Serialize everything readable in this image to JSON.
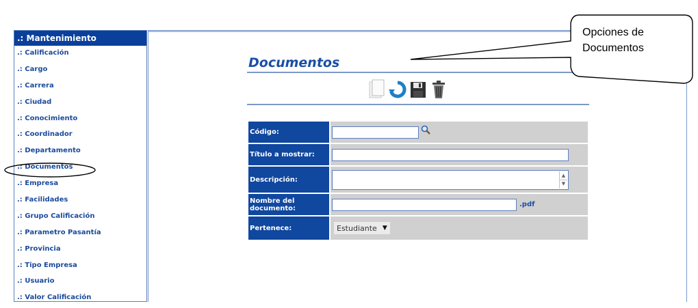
{
  "sidebar": {
    "header": ".: Mantenimiento",
    "bullet": ".:",
    "items": [
      {
        "label": "Calificación"
      },
      {
        "label": "Cargo"
      },
      {
        "label": "Carrera"
      },
      {
        "label": "Ciudad"
      },
      {
        "label": "Conocimiento"
      },
      {
        "label": "Coordinador"
      },
      {
        "label": "Departamento"
      },
      {
        "label": "Documentos"
      },
      {
        "label": "Empresa"
      },
      {
        "label": "Facilidades"
      },
      {
        "label": "Grupo Calificación"
      },
      {
        "label": "Parametro Pasantía"
      },
      {
        "label": "Provincia"
      },
      {
        "label": "Tipo Empresa"
      },
      {
        "label": "Usuario"
      },
      {
        "label": "Valor Calificación"
      }
    ]
  },
  "main": {
    "title": "Documentos",
    "toolbar": {
      "icons": [
        "new-document-icon",
        "refresh-icon",
        "save-icon",
        "delete-icon"
      ]
    },
    "form": {
      "codigo_label": "Código:",
      "codigo_value": "",
      "titulo_label": "Título a mostrar:",
      "titulo_value": "",
      "descripcion_label": "Descripción:",
      "descripcion_value": "",
      "nombre_label": "Nombre del documento:",
      "nombre_value": "",
      "nombre_suffix": ".pdf",
      "pertenece_label": "Pertenece:",
      "pertenece_selected": "Estudiante"
    }
  },
  "callout": {
    "text": "Opciones de Documentos"
  },
  "colors": {
    "sidebar_header": "#0a3f9b",
    "link": "#1a4a9c",
    "form_label_bg": "#10479f",
    "form_field_bg": "#d0d0d0"
  }
}
